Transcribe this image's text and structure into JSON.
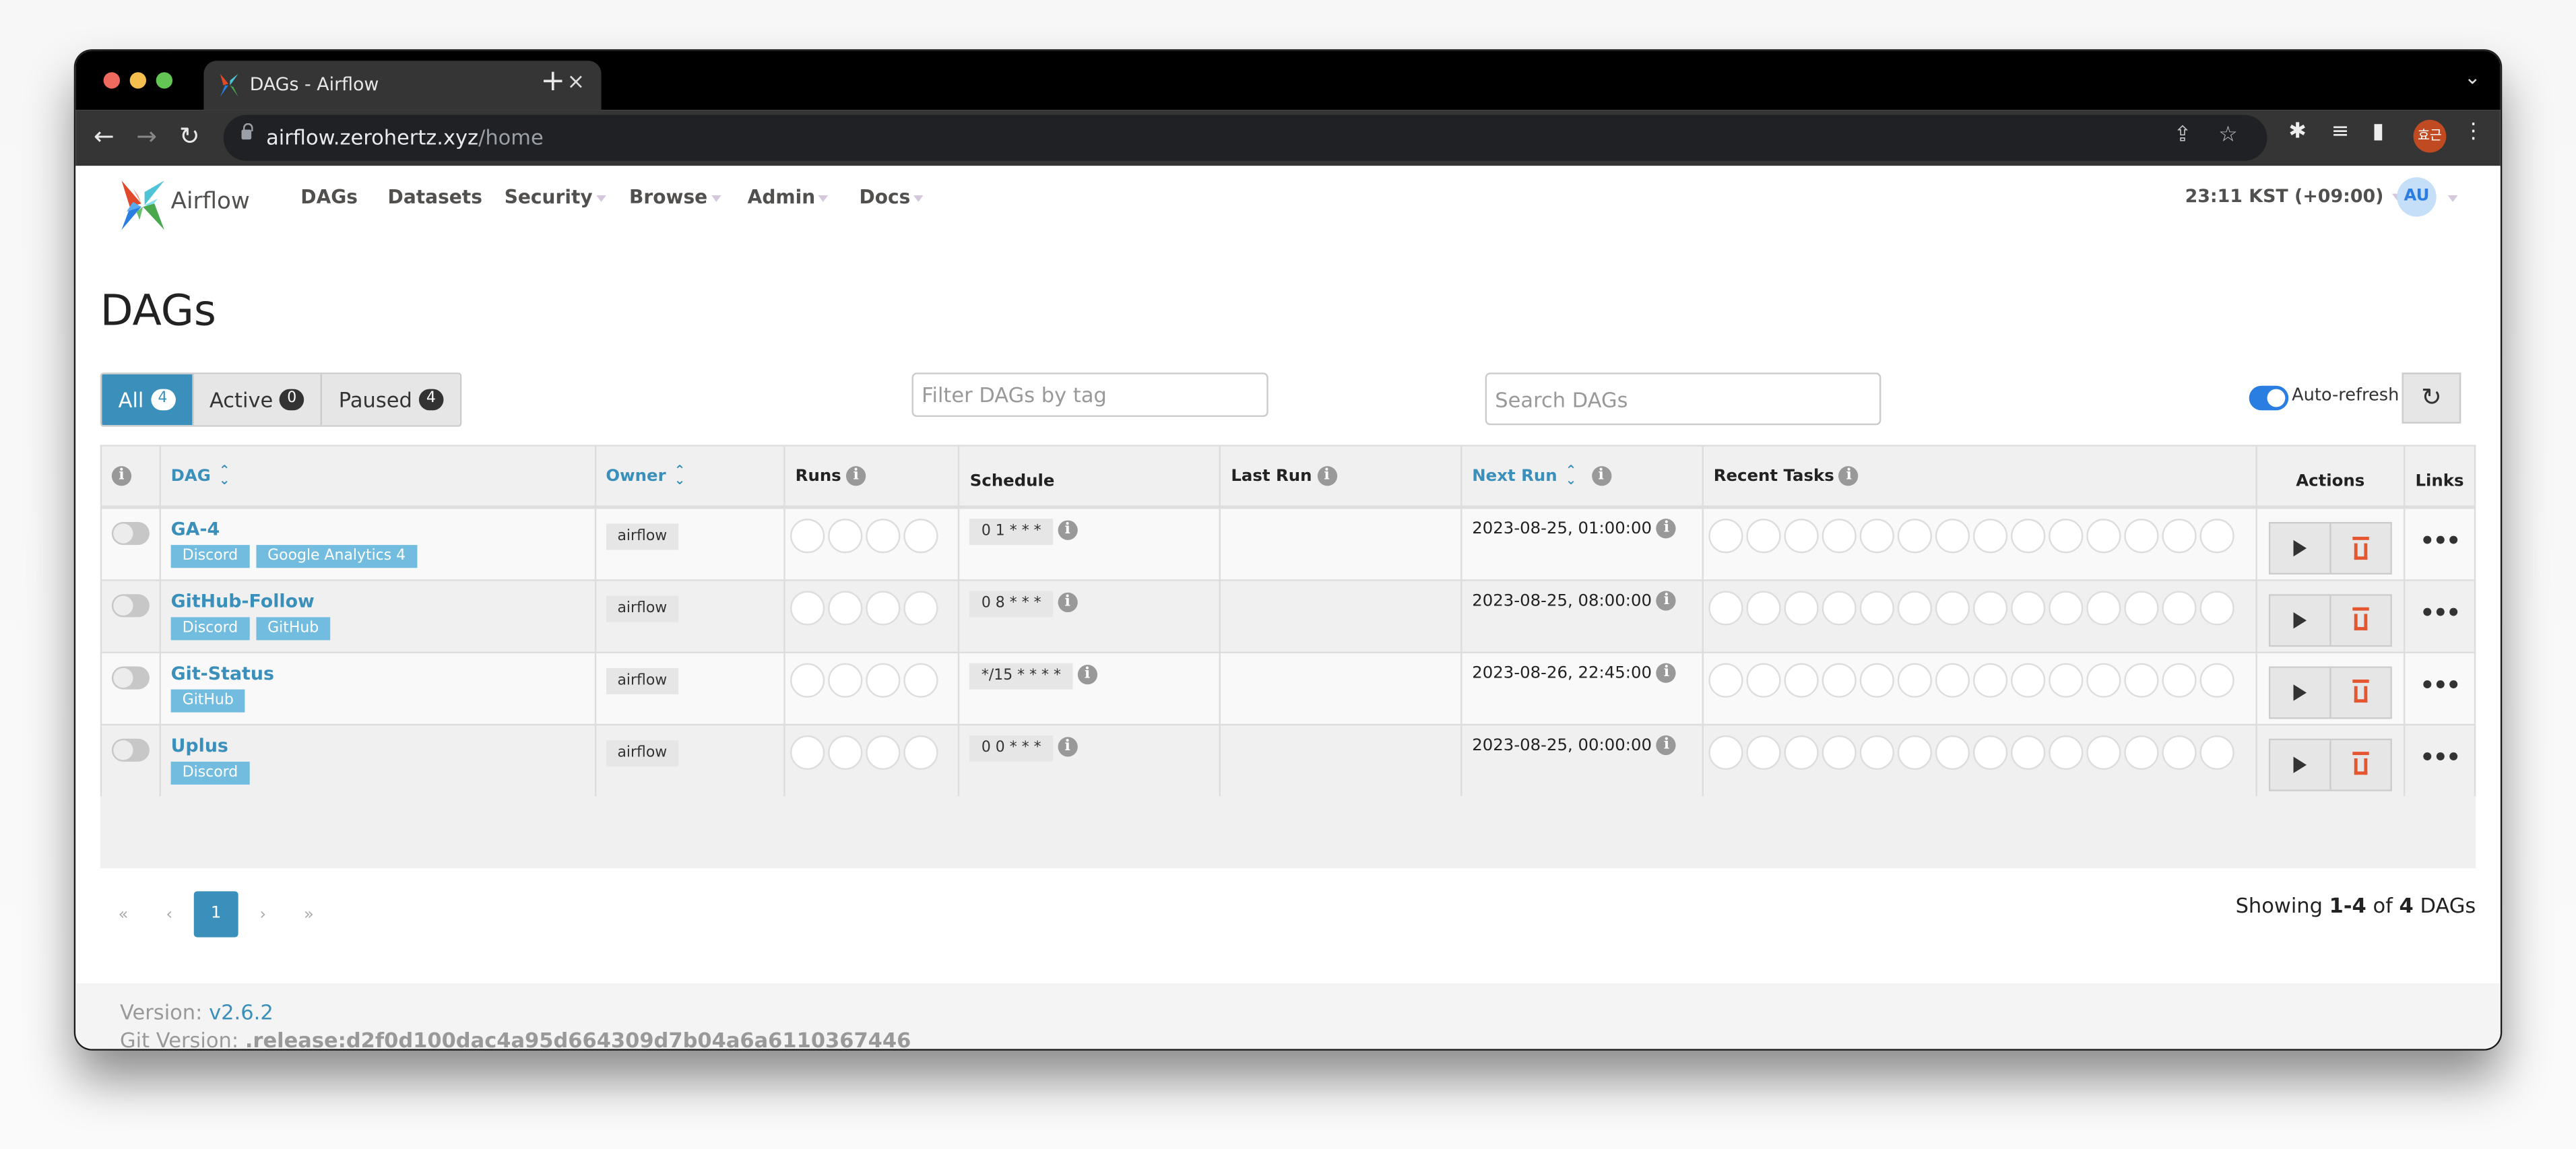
{
  "browser": {
    "tab_title": "DAGs - Airflow",
    "url_host": "airflow.zerohertz.xyz",
    "url_path": "/home",
    "profile_initials": "효근"
  },
  "navbar": {
    "brand": "Airflow",
    "menu": [
      {
        "label": "DAGs",
        "dropdown": false
      },
      {
        "label": "Datasets",
        "dropdown": false
      },
      {
        "label": "Security",
        "dropdown": true
      },
      {
        "label": "Browse",
        "dropdown": true
      },
      {
        "label": "Admin",
        "dropdown": true
      },
      {
        "label": "Docs",
        "dropdown": true
      }
    ],
    "clock": "23:11 KST (+09:00)",
    "user_initials": "AU"
  },
  "page": {
    "title": "DAGs",
    "status_filters": [
      {
        "label": "All",
        "count": "4",
        "active": true
      },
      {
        "label": "Active",
        "count": "0",
        "active": false
      },
      {
        "label": "Paused",
        "count": "4",
        "active": false
      }
    ],
    "tag_filter_placeholder": "Filter DAGs by tag",
    "search_placeholder": "Search DAGs",
    "auto_refresh_label": "Auto-refresh",
    "auto_refresh_on": true
  },
  "table": {
    "headers": {
      "dag": "DAG",
      "owner": "Owner",
      "runs": "Runs",
      "schedule": "Schedule",
      "last_run": "Last Run",
      "next_run": "Next Run",
      "recent_tasks": "Recent Tasks",
      "actions": "Actions",
      "links": "Links"
    },
    "rows": [
      {
        "dag_id": "GA-4",
        "tags": [
          "Discord",
          "Google Analytics 4"
        ],
        "owner": "airflow",
        "schedule": "0 1 * * *",
        "last_run": "",
        "next_run": "2023-08-25, 01:00:00",
        "paused": true
      },
      {
        "dag_id": "GitHub-Follow",
        "tags": [
          "Discord",
          "GitHub"
        ],
        "owner": "airflow",
        "schedule": "0 8 * * *",
        "last_run": "",
        "next_run": "2023-08-25, 08:00:00",
        "paused": true
      },
      {
        "dag_id": "Git-Status",
        "tags": [
          "GitHub"
        ],
        "owner": "airflow",
        "schedule": "*/15 * * * *",
        "last_run": "",
        "next_run": "2023-08-26, 22:45:00",
        "paused": true
      },
      {
        "dag_id": "Uplus",
        "tags": [
          "Discord"
        ],
        "owner": "airflow",
        "schedule": "0 0 * * *",
        "last_run": "",
        "next_run": "2023-08-25, 00:00:00",
        "paused": true
      }
    ],
    "runs_circles": 4,
    "recent_task_circles": 14
  },
  "pagination": {
    "first": "«",
    "prev": "‹",
    "current": "1",
    "next": "›",
    "last": "»",
    "showing_prefix": "Showing ",
    "showing_range": "1-4",
    "showing_mid": " of ",
    "showing_total": "4",
    "showing_suffix": " DAGs"
  },
  "footer": {
    "version_label": "Version: ",
    "version": "v2.6.2",
    "git_label": "Git Version: ",
    "git_version": ".release:d2f0d100dac4a95d664309d7b04a6a6110367446"
  },
  "colors": {
    "primary": "#3a8fbb",
    "tag": "#72bddf",
    "delete": "#e5552f",
    "toggle_on": "#2a7de1"
  }
}
